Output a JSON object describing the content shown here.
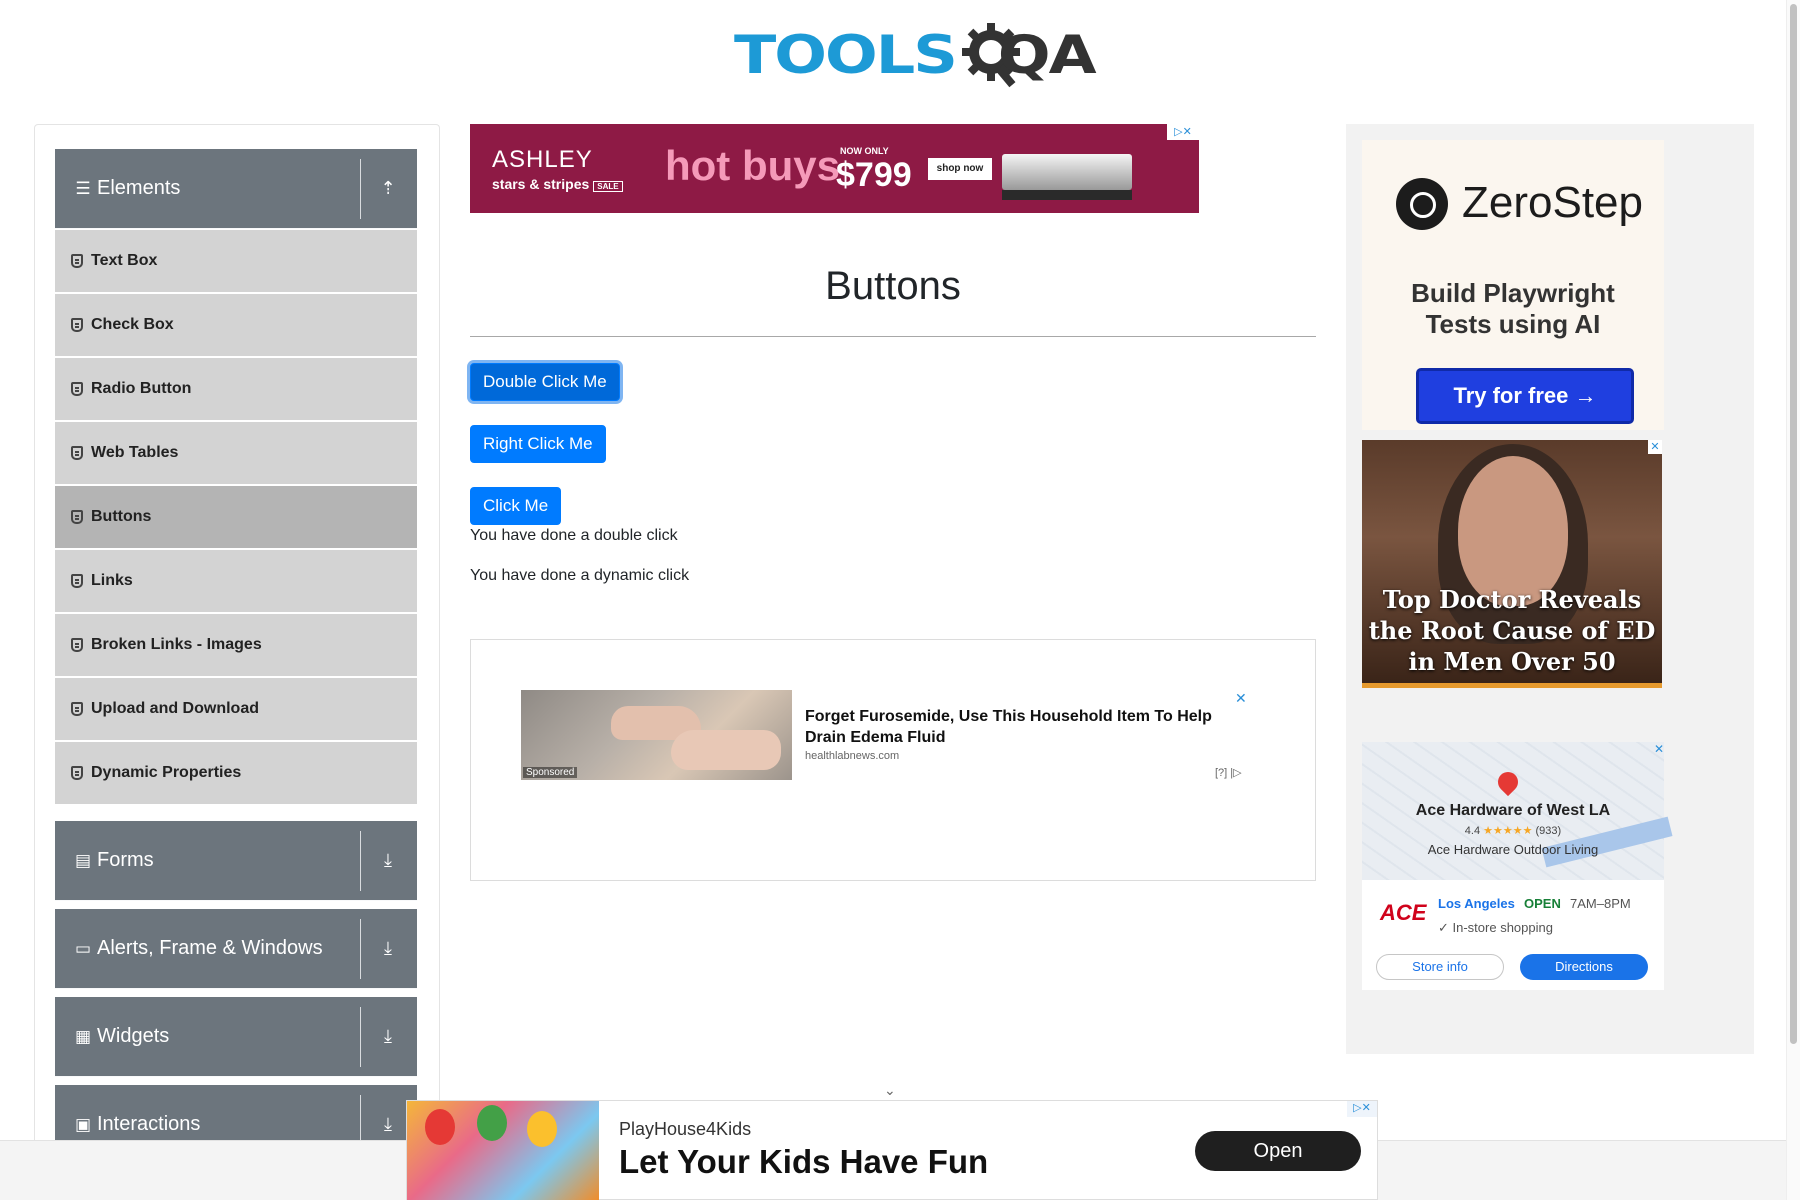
{
  "header": {
    "logo_tools": "TOOLS",
    "logo_qa": "QA"
  },
  "sidebar": {
    "groups": [
      {
        "label": "Elements",
        "icon": "hamburger-icon",
        "arrow": "expand-up-icon"
      },
      {
        "label": "Forms",
        "icon": "form-icon",
        "arrow": "download-arrow-icon"
      },
      {
        "label": "Alerts, Frame & Windows",
        "icon": "window-icon",
        "arrow": "download-arrow-icon"
      },
      {
        "label": "Widgets",
        "icon": "widgets-icon",
        "arrow": "download-arrow-icon"
      },
      {
        "label": "Interactions",
        "icon": "interactions-icon",
        "arrow": "download-arrow-icon"
      }
    ],
    "items": [
      {
        "label": "Text Box"
      },
      {
        "label": "Check Box"
      },
      {
        "label": "Radio Button"
      },
      {
        "label": "Web Tables"
      },
      {
        "label": "Buttons",
        "active": true
      },
      {
        "label": "Links"
      },
      {
        "label": "Broken Links - Images"
      },
      {
        "label": "Upload and Download"
      },
      {
        "label": "Dynamic Properties"
      }
    ]
  },
  "main": {
    "title": "Buttons",
    "buttons": {
      "double_click": "Double Click Me",
      "right_click": "Right Click Me",
      "click": "Click Me"
    },
    "messages": {
      "double": "You have done a double click",
      "dynamic": "You have done a dynamic click"
    }
  },
  "ads": {
    "top": {
      "brand": "ASHLEY",
      "sub": "stars & stripes",
      "sale": "SALE",
      "headline": "hot buys",
      "now_only": "NOW ONLY",
      "price": "$799",
      "cta": "shop now"
    },
    "middle": {
      "sponsored": "Sponsored",
      "headline": "Forget Furosemide, Use This Household Item To Help Drain Edema Fluid",
      "domain": "healthlabnews.com",
      "adchoice": "[?] |▷"
    },
    "zerostep": {
      "name": "ZeroStep",
      "tagline_1": "Build Playwright",
      "tagline_2": "Tests using AI",
      "cta": "Try for free →"
    },
    "doctor": {
      "text": "Top Doctor Reveals the Root Cause of ED in Men Over 50"
    },
    "ace": {
      "name": "Ace Hardware of West LA",
      "rating": "4.4",
      "stars": "★★★★★",
      "reviews": "(933)",
      "store_label": "Ace Hardware Outdoor Living",
      "logo": "ACE",
      "city": "Los Angeles",
      "status": "OPEN",
      "hours": "7AM–8PM",
      "instore": "✓ In-store shopping",
      "btn_store": "Store info",
      "btn_directions": "Directions"
    },
    "bottom": {
      "brand": "PlayHouse4Kids",
      "tagline": "Let Your Kids Have Fun",
      "cta": "Open"
    }
  },
  "colors": {
    "primary_button": "#007bff",
    "sidebar_header": "#6c757d",
    "sidebar_item": "#d3d3d3",
    "sidebar_item_active": "#b4b4b4",
    "logo_blue": "#1d9ad6"
  }
}
